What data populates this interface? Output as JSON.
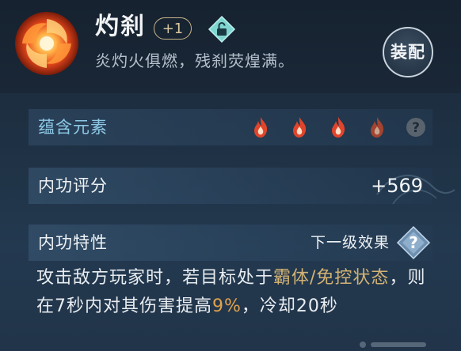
{
  "skill": {
    "name": "灼刹",
    "level_badge": "+1",
    "icon": "fire-vortex-icon",
    "subtitle": "炎灼火俱燃，残刹荧煌满。",
    "lock_icon": "unlock-diamond-icon",
    "equip_label": "装配"
  },
  "elements": {
    "label": "蕴含元素",
    "icons": [
      "fire-element-icon",
      "fire-element-icon",
      "fire-element-icon",
      "fire-element-dim-icon",
      "question-icon"
    ],
    "fire_color": "#e0452c"
  },
  "score": {
    "label": "内功评分",
    "value": "+569"
  },
  "trait": {
    "label": "内功特性",
    "next_level_label": "下一级效果",
    "help_icon": "question-diamond-icon"
  },
  "description": {
    "part1": "攻击敌方玩家时，若目标处于",
    "highlight1": "霸体/免控状态",
    "part2": "，则在7秒内对其伤害提高",
    "highlight2": "9%",
    "part3": "，冷却20秒"
  },
  "colors": {
    "gold_highlight": "#d3b274",
    "percent_highlight": "#e0a24c",
    "element_label": "#8ec9e6"
  }
}
